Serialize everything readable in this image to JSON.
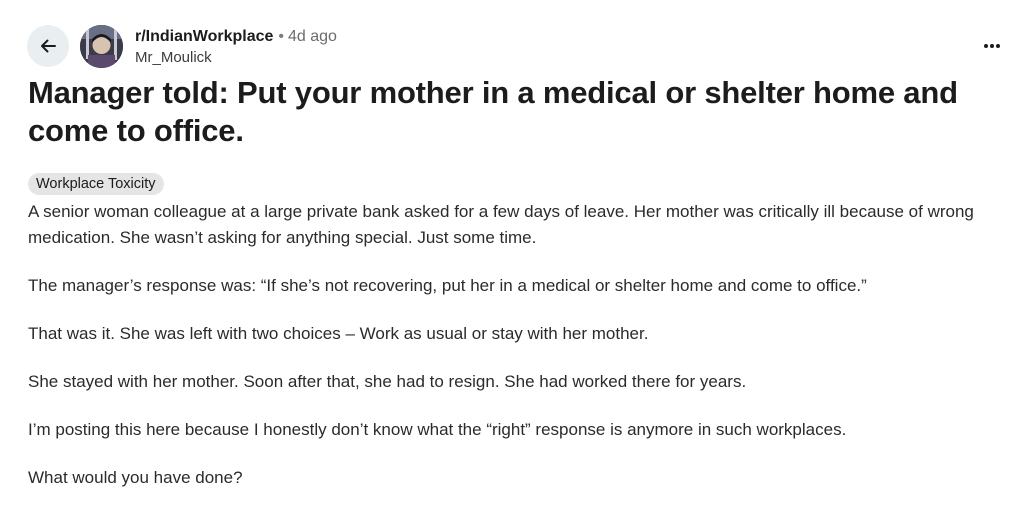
{
  "header": {
    "back_icon": "arrow-left-icon",
    "subreddit": "r/IndianWorkplace",
    "separator": "•",
    "age": "4d ago",
    "author": "Mr_Moulick",
    "more_icon": "more-horizontal-icon"
  },
  "post": {
    "title": "Manager told: Put your mother in a medical or shelter home and come to office.",
    "flair": "Workplace Toxicity",
    "paragraphs": [
      "A senior woman colleague at a large private bank asked for a few days of leave. Her mother was critically ill because of wrong medication. She wasn’t asking for anything special. Just some time.",
      "The manager’s response was: “If she’s not recovering, put her in a medical or shelter home and come to office.”",
      "That was it. She was left with two choices – Work as usual or stay with her mother.",
      "She stayed with her mother. Soon after that, she had to resign. She had worked there for years.",
      "I’m posting this here because I honestly don’t know what the “right” response is anymore in such workplaces.",
      "What would you have done?"
    ]
  },
  "colors": {
    "text": "#1c1c1c",
    "muted": "#6b6b6b",
    "back_button_bg": "#e9eef1",
    "flair_bg": "#e5e5e5"
  }
}
